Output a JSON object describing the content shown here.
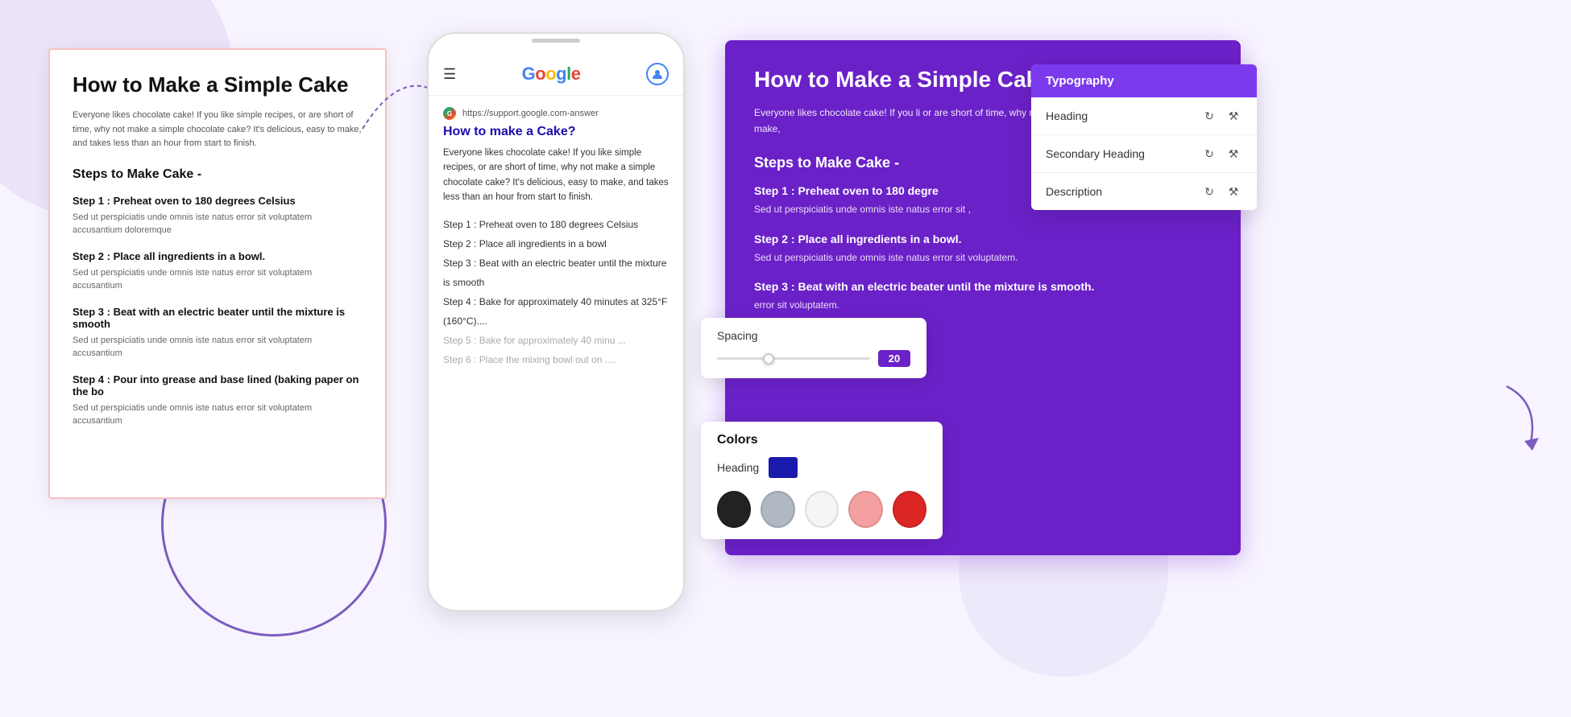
{
  "background": {
    "color": "#f8f4ff"
  },
  "left_panel": {
    "doc_title": "How to Make a Simple Cake",
    "doc_intro": "Everyone likes chocolate cake! If you like simple recipes, or are short of time, why not make a simple chocolate cake? It's delicious, easy to make, and takes less than an hour from start to finish.",
    "section_heading": "Steps to Make Cake -",
    "steps": [
      {
        "title": "Step 1 : Preheat oven to 180 degrees Celsius",
        "desc": "Sed ut perspiciatis unde omnis iste natus error sit voluptatem accusantium doloremque"
      },
      {
        "title": "Step 2 : Place all ingredients in a bowl.",
        "desc": "Sed ut perspiciatis unde omnis iste natus error sit voluptatem accusantium"
      },
      {
        "title": "Step 3 : Beat with an electric beater until the mixture is smooth",
        "desc": "Sed ut perspiciatis unde omnis iste natus error sit voluptatem accusantium"
      },
      {
        "title": "Step 4 : Pour into grease and base lined (baking paper on the bo",
        "desc": "Sed ut perspiciatis unde omnis iste natus error sit voluptatem accusantium"
      }
    ]
  },
  "phone_panel": {
    "url": "https://support.google.com-answer",
    "result_title": "How to make a Cake?",
    "snippet": "Everyone likes chocolate cake! If you like simple recipes, or are short of time, why not make a simple chocolate cake? It's delicious, easy to make, and takes less than an hour from start to finish.",
    "steps": [
      "Step 1 : Preheat oven to 180 degrees Celsius",
      "Step 2 : Place all ingredients in a bowl",
      "Step 3 : Beat with an electric beater until the mixture is smooth",
      "Step 4 : Bake for approximately 40 minutes at 325°F (160°C)....",
      "Step 5 : Bake for approximately 40 minu ...",
      "Step 6 : Place the mixing bowl out on ...."
    ]
  },
  "right_panel": {
    "card": {
      "title": "How to Make a Simple Cake",
      "intro": "Everyone likes chocolate cake! If you li or are short of time, why not make a si ake? It's delicious, easy to make,",
      "section_heading": "Steps to Make Cake -",
      "steps": [
        {
          "title": "Step 1 : Preheat oven to 180 degre",
          "desc": "Sed ut perspiciatis unde omnis iste natus error sit ,"
        },
        {
          "title": "Step 2 : Place all ingredients in a bowl.",
          "desc": "Sed ut perspiciatis unde omnis iste natus error sit voluptatem."
        },
        {
          "title": "Step 3 : Beat with an electric beater until the mixture is smooth.",
          "desc": "error sit voluptatem."
        }
      ]
    },
    "settings_panel": {
      "header_label": "Typography",
      "rows": [
        {
          "label": "Heading"
        },
        {
          "label": "Secondary Heading"
        },
        {
          "label": "Description"
        }
      ]
    },
    "spacing": {
      "label": "Spacing",
      "value": "20"
    },
    "colors": {
      "title": "Colors",
      "heading_label": "Heading",
      "swatches": [
        "black",
        "gray",
        "white",
        "pink",
        "red"
      ]
    }
  }
}
